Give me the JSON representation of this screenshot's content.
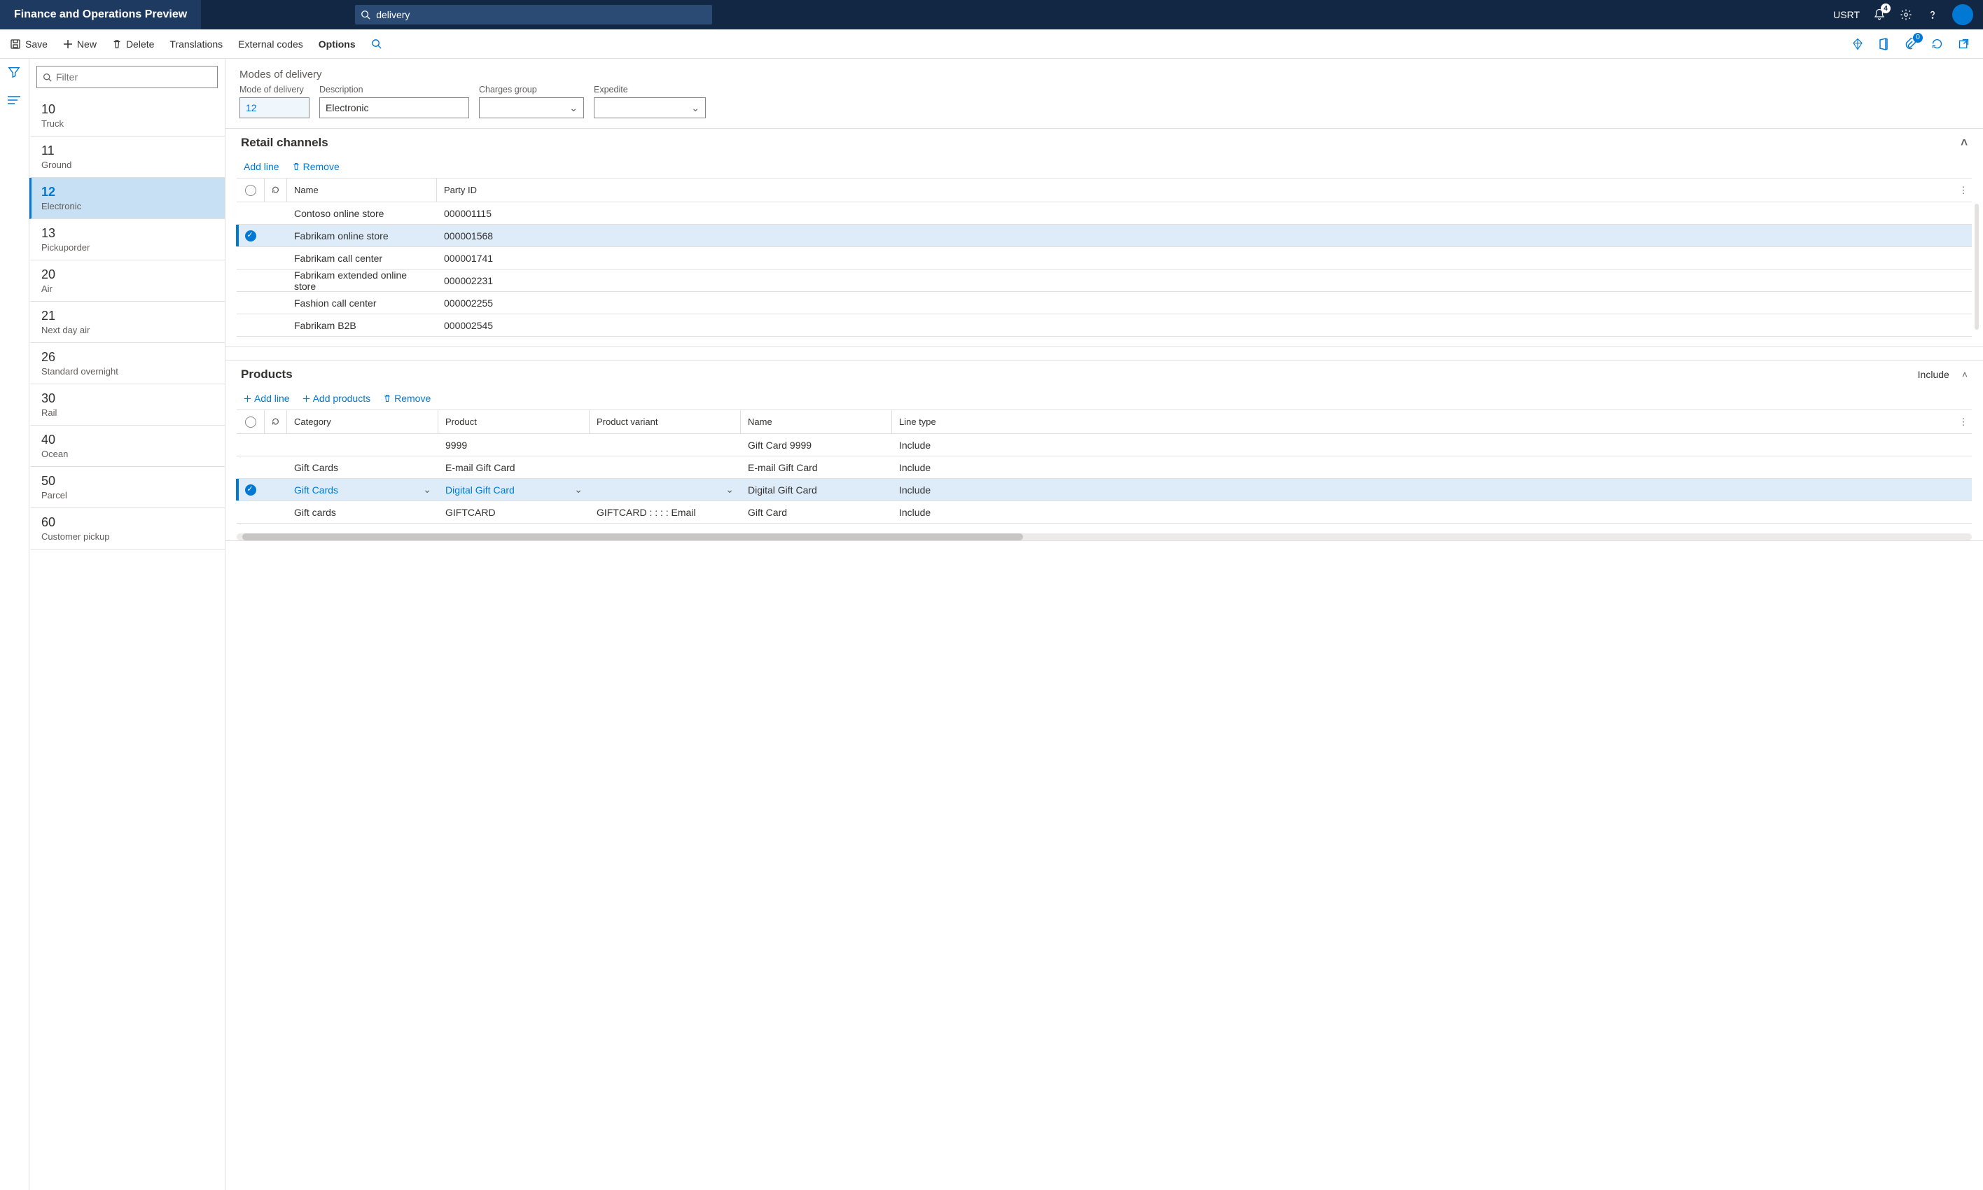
{
  "topbar": {
    "title": "Finance and Operations Preview",
    "search_value": "delivery",
    "user": "USRT",
    "notif_count": "4"
  },
  "actionbar": {
    "save": "Save",
    "new": "New",
    "delete": "Delete",
    "translations": "Translations",
    "external_codes": "External codes",
    "options": "Options",
    "attach_count": "0"
  },
  "list_filter_placeholder": "Filter",
  "modes": [
    {
      "code": "10",
      "desc": "Truck"
    },
    {
      "code": "11",
      "desc": "Ground"
    },
    {
      "code": "12",
      "desc": "Electronic",
      "selected": true
    },
    {
      "code": "13",
      "desc": "Pickuporder"
    },
    {
      "code": "20",
      "desc": "Air"
    },
    {
      "code": "21",
      "desc": "Next day air"
    },
    {
      "code": "26",
      "desc": "Standard overnight"
    },
    {
      "code": "30",
      "desc": "Rail"
    },
    {
      "code": "40",
      "desc": "Ocean"
    },
    {
      "code": "50",
      "desc": "Parcel"
    },
    {
      "code": "60",
      "desc": "Customer pickup"
    }
  ],
  "page_title": "Modes of delivery",
  "fields": {
    "mode_label": "Mode of delivery",
    "mode_value": "12",
    "desc_label": "Description",
    "desc_value": "Electronic",
    "charges_label": "Charges group",
    "charges_value": "",
    "expedite_label": "Expedite",
    "expedite_value": ""
  },
  "retail": {
    "title": "Retail channels",
    "add": "Add line",
    "remove": "Remove",
    "cols": {
      "name": "Name",
      "party": "Party ID"
    },
    "rows": [
      {
        "name": "Contoso online store",
        "party": "000001115"
      },
      {
        "name": "Fabrikam online store",
        "party": "000001568",
        "selected": true
      },
      {
        "name": "Fabrikam call center",
        "party": "000001741"
      },
      {
        "name": "Fabrikam extended online store",
        "party": "000002231"
      },
      {
        "name": "Fashion call center",
        "party": "000002255"
      },
      {
        "name": "Fabrikam B2B",
        "party": "000002545"
      }
    ]
  },
  "products": {
    "title": "Products",
    "include_label": "Include",
    "add_line": "Add line",
    "add_products": "Add products",
    "remove": "Remove",
    "cols": {
      "category": "Category",
      "product": "Product",
      "variant": "Product variant",
      "name": "Name",
      "linetype": "Line type"
    },
    "rows": [
      {
        "category": "",
        "product": "9999",
        "variant": "",
        "name": "Gift Card 9999",
        "linetype": "Include"
      },
      {
        "category": "Gift Cards",
        "product": "E-mail Gift Card",
        "variant": "",
        "name": "E-mail Gift Card",
        "linetype": "Include"
      },
      {
        "category": "Gift Cards",
        "product": "Digital Gift Card",
        "variant": "",
        "name": "Digital Gift Card",
        "linetype": "Include",
        "selected": true
      },
      {
        "category": "Gift cards",
        "product": "GIFTCARD",
        "variant": "GIFTCARD :  :  :  : Email",
        "name": "Gift Card",
        "linetype": "Include"
      }
    ]
  }
}
